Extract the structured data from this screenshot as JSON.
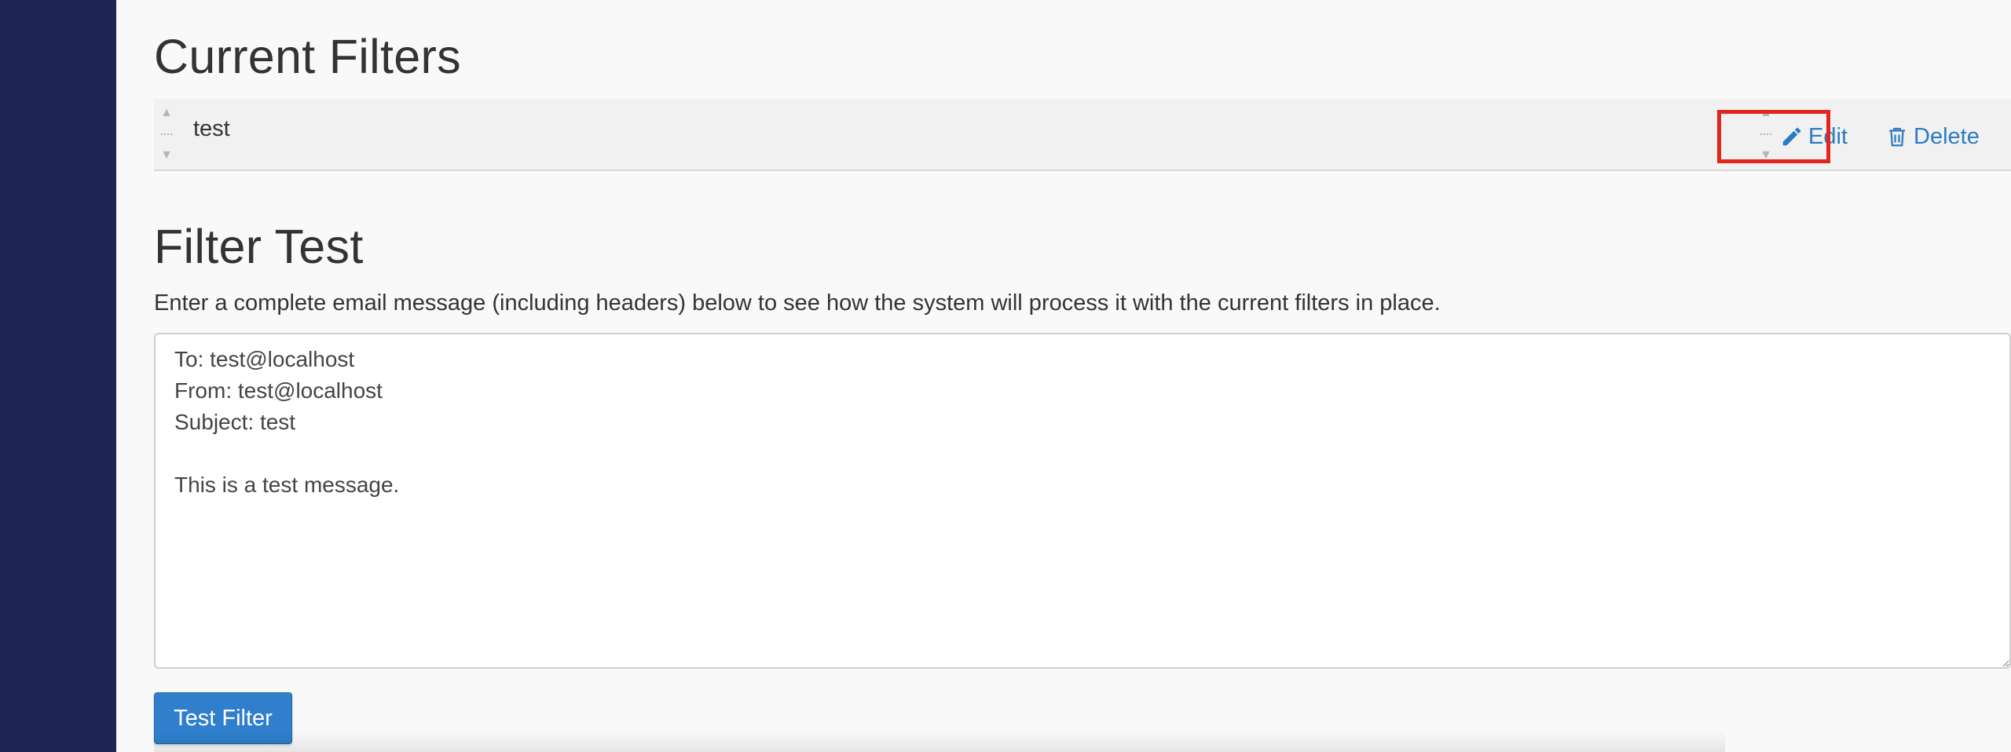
{
  "current_filters": {
    "title": "Current Filters",
    "filters": [
      {
        "name": "test",
        "edit_label": "Edit",
        "delete_label": "Delete"
      }
    ]
  },
  "filter_test": {
    "title": "Filter Test",
    "description": "Enter a complete email message (including headers) below to see how the system will process it with the current filters in place.",
    "message_value": "To: test@localhost\nFrom: test@localhost\nSubject: test\n\nThis is a test message.",
    "button_label": "Test Filter"
  },
  "colors": {
    "sidebar": "#1f2654",
    "link": "#2d7bc4",
    "button": "#2f7fcc",
    "highlight": "#e3261b"
  },
  "icons": {
    "edit": "pencil-icon",
    "delete": "trash-icon",
    "drag": "drag-handle-icon"
  }
}
